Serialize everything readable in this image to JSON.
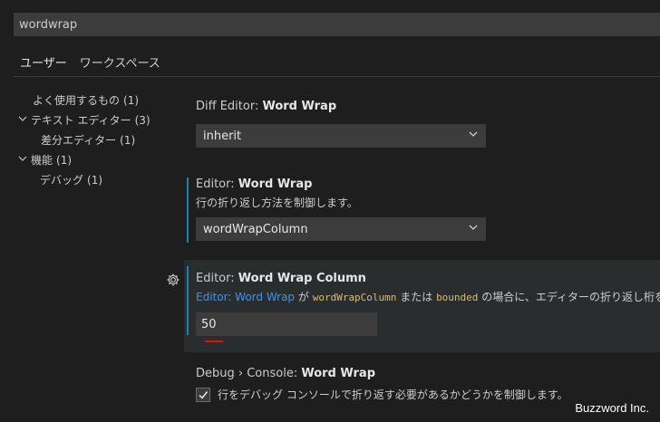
{
  "search": {
    "value": "wordwrap"
  },
  "tabs": [
    {
      "label": "ユーザー",
      "active": true
    },
    {
      "label": "ワークスペース",
      "active": false
    }
  ],
  "toc": [
    {
      "label": "よく使用するもの",
      "count": "(1)",
      "chevron": ""
    },
    {
      "label": "テキスト エディター",
      "count": "(3)",
      "chevron": "down"
    },
    {
      "label": "差分エディター",
      "count": "(1)",
      "chevron": ""
    },
    {
      "label": "機能",
      "count": "(1)",
      "chevron": "down"
    },
    {
      "label": "デバッグ",
      "count": "(1)",
      "chevron": ""
    }
  ],
  "settings": {
    "diff": {
      "category": "Diff Editor: ",
      "name": "Word Wrap",
      "value": "inherit"
    },
    "editor_wrap": {
      "category": "Editor: ",
      "name": "Word Wrap",
      "description": "行の折り返し方法を制御します。",
      "value": "wordWrapColumn"
    },
    "wrap_column": {
      "category": "Editor: ",
      "name": "Word Wrap Column",
      "desc_link": "Editor: Word Wrap",
      "desc_part1": " が ",
      "desc_code1": "wordWrapColumn",
      "desc_part2": " または ",
      "desc_code2": "bounded",
      "desc_part3": " の場合に、エディターの折り返し桁を制御",
      "value": "50"
    },
    "debug_console": {
      "category": "Debug › Console: ",
      "name": "Word Wrap",
      "description": "行をデバッグ コンソールで折り返す必要があるかどうかを制御します。",
      "checked": true
    }
  },
  "watermark": "Buzzword Inc.",
  "colors": {
    "accent": "#1b80b2",
    "link": "#3794ff",
    "modified_marker": "#e51400"
  }
}
